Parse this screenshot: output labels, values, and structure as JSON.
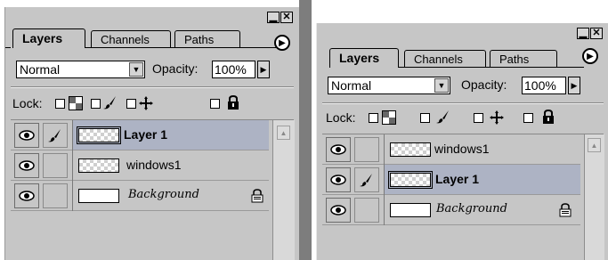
{
  "panels": [
    {
      "id": "left",
      "window_buttons": {
        "minimize": "▁",
        "close": "✕"
      },
      "tabs": [
        "Layers",
        "Channels",
        "Paths"
      ],
      "active_tab": "Layers",
      "blend_mode": "Normal",
      "opacity_label": "Opacity:",
      "opacity_value": "100%",
      "lock_label": "Lock:",
      "layers": [
        {
          "name": "Layer 1",
          "selected": true,
          "thumb": "checker",
          "brush": true,
          "locked": false
        },
        {
          "name": "windows1",
          "selected": false,
          "thumb": "checker",
          "brush": false,
          "locked": false
        },
        {
          "name": "Background",
          "selected": false,
          "thumb": "white",
          "brush": false,
          "locked": true
        }
      ]
    },
    {
      "id": "right",
      "window_buttons": {
        "minimize": "▁",
        "close": "✕"
      },
      "tabs": [
        "Layers",
        "Channels",
        "Paths"
      ],
      "active_tab": "Layers",
      "blend_mode": "Normal",
      "opacity_label": "Opacity:",
      "opacity_value": "100%",
      "lock_label": "Lock:",
      "layers": [
        {
          "name": "windows1",
          "selected": false,
          "thumb": "checker",
          "brush": false,
          "locked": false
        },
        {
          "name": "Layer 1",
          "selected": true,
          "thumb": "checker",
          "brush": true,
          "locked": false
        },
        {
          "name": "Background",
          "selected": false,
          "thumb": "white",
          "brush": false,
          "locked": true
        }
      ]
    }
  ],
  "colors": {
    "panel_bg": "#c6c6c6",
    "selected_row": "#adb3c4",
    "separator": "#7d7d7d"
  },
  "icons": [
    "eye-icon",
    "brush-icon",
    "lock-icon",
    "move-icon",
    "transparency-lock-icon",
    "panel-menu-arrow-icon"
  ]
}
